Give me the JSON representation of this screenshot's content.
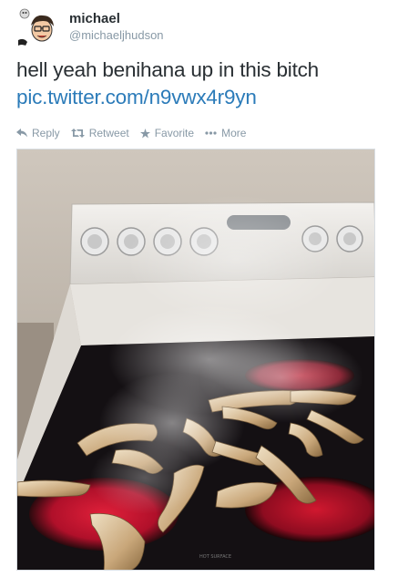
{
  "user": {
    "name": "michael",
    "handle": "@michaeljhudson",
    "avatar_icon": "cartoon-avatar-icon"
  },
  "tweet": {
    "text": "hell yeah benihana up in this bitch",
    "link": "pic.twitter.com/n9vwx4r9yn"
  },
  "actions": {
    "reply_label": "Reply",
    "retweet_label": "Retweet",
    "favorite_label": "Favorite",
    "more_label": "More",
    "reply_icon": "reply-arrow-icon",
    "retweet_icon": "retweet-icon",
    "favorite_icon": "star-icon",
    "more_icon": "ellipsis-icon"
  },
  "photo": {
    "stove_label": "HOT SURFACE",
    "description_icon": "stove-photo"
  },
  "colors": {
    "link": "#2b7bb9",
    "meta": "#8899a6",
    "text": "#292f33"
  }
}
